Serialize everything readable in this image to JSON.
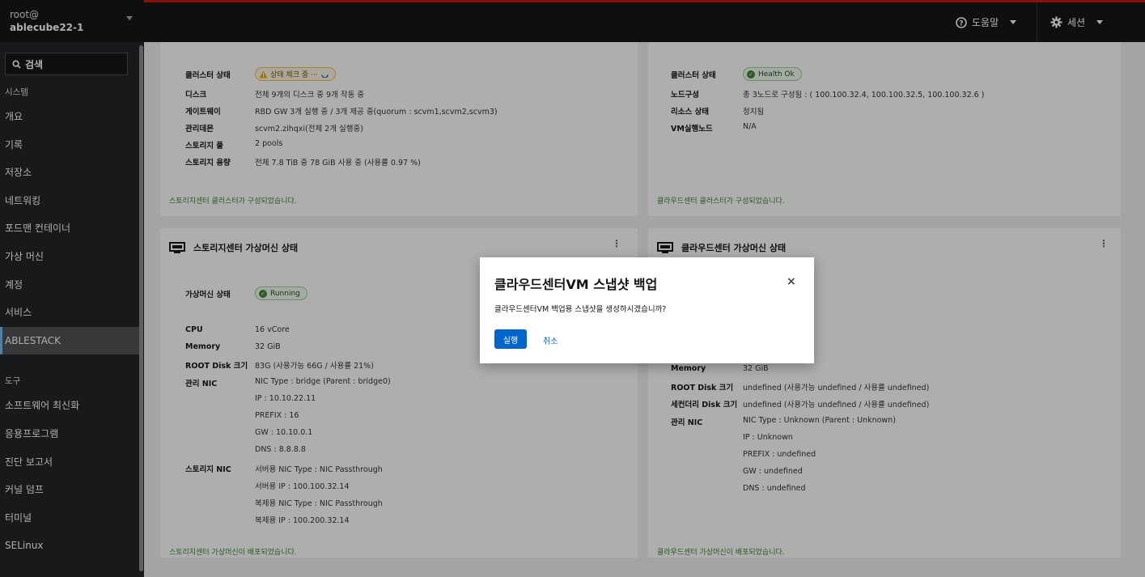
{
  "host": {
    "user": "root@",
    "name": "ablecube22-1"
  },
  "search": {
    "label": "검색"
  },
  "sidebar": {
    "items": [
      {
        "label": "시스템",
        "type": "section"
      },
      {
        "label": "개요"
      },
      {
        "label": "기록"
      },
      {
        "label": "저장소"
      },
      {
        "label": "네트워킹"
      },
      {
        "label": "포드맨 컨테이너"
      },
      {
        "label": "가상 머신"
      },
      {
        "label": "계정"
      },
      {
        "label": "서비스"
      },
      {
        "label": "ABLESTACK",
        "active": true
      },
      {
        "label": "도구",
        "type": "section"
      },
      {
        "label": "소프트웨어 최신화"
      },
      {
        "label": "응용프로그램"
      },
      {
        "label": "진단 보고서"
      },
      {
        "label": "커널 덤프"
      },
      {
        "label": "터미널"
      },
      {
        "label": "SELinux"
      }
    ]
  },
  "topbar": {
    "help": "도움말",
    "session": "세션"
  },
  "storage_cluster": {
    "status_label": "클러스터 상태",
    "status_badge": "상태 체크 중 ···",
    "rows": [
      {
        "k": "디스크",
        "v": "전체 9개의 디스크 중 9개 작동 중"
      },
      {
        "k": "게이트웨이",
        "v": "RBD GW 3개 실행 중 / 3개 제공 중(quorum : scvm1,scvm2,scvm3)"
      },
      {
        "k": "관리데몬",
        "v": "scvm2.zihqxi(전체 2개 실행중)"
      },
      {
        "k": "스토리지 풀",
        "v": "2 pools"
      },
      {
        "k": "스토리지 용량",
        "v": "전체 7.8 TiB 중 78 GiB 사용 중 (사용률 0.97 %)"
      }
    ],
    "footer": "스토리지센터 클러스터가 구성되었습니다."
  },
  "cloud_cluster": {
    "status_label": "클러스터 상태",
    "status_badge": "Health Ok",
    "rows": [
      {
        "k": "노드구성",
        "v": "총 3노드로 구성됨 : ( 100.100.32.4, 100.100.32.5, 100.100.32.6 )"
      },
      {
        "k": "리소스 상태",
        "v": "정지됨"
      },
      {
        "k": "VM실행노드",
        "v": "N/A"
      }
    ],
    "footer": "클라우드센터 클러스터가 구성되었습니다."
  },
  "storage_vm": {
    "title": "스토리지센터 가상머신 상태",
    "status_label": "가상머신 상태",
    "status_badge": "Running",
    "rows": [
      {
        "k": "CPU",
        "v": "16 vCore"
      },
      {
        "k": "Memory",
        "v": "32 GiB"
      },
      {
        "k": "ROOT Disk 크기",
        "v": "83G (사용가능 66G / 사용률 21%)"
      },
      {
        "k": "관리 NIC",
        "v": "NIC Type : bridge (Parent : bridge0)"
      },
      {
        "k": "",
        "v": "IP : 10.10.22.11"
      },
      {
        "k": "",
        "v": "PREFIX : 16"
      },
      {
        "k": "",
        "v": "GW : 10.10.0.1"
      },
      {
        "k": "",
        "v": "DNS : 8.8.8.8"
      },
      {
        "k": "스토리지 NIC",
        "v": "서버용 NIC Type : NIC Passthrough"
      },
      {
        "k": "",
        "v": "서버용 IP : 100.100.32.14"
      },
      {
        "k": "",
        "v": "복제용 NIC Type : NIC Passthrough"
      },
      {
        "k": "",
        "v": "복제용 IP : 100.200.32.14"
      }
    ],
    "footer": "스토리지센터 가상머신이 배포되었습니다."
  },
  "cloud_vm": {
    "title": "클라우드센터 가상머신 상태",
    "rows": [
      {
        "k": "Memory",
        "v": "32 GiB"
      },
      {
        "k": "ROOT Disk 크기",
        "v": "undefined (사용가능 undefined / 사용률 undefined)"
      },
      {
        "k": "세컨더리 Disk 크기",
        "v": "undefined (사용가능 undefined / 사용률 undefined)"
      },
      {
        "k": "관리 NIC",
        "v": "NIC Type : Unknown (Parent : Unknown)"
      },
      {
        "k": "",
        "v": "IP : Unknown"
      },
      {
        "k": "",
        "v": "PREFIX : undefined"
      },
      {
        "k": "",
        "v": "GW : undefined"
      },
      {
        "k": "",
        "v": "DNS : undefined"
      }
    ],
    "footer": "클라우드센터 가상머신이 배포되었습니다."
  },
  "modal": {
    "title": "클라우드센터VM 스냅샷 백업",
    "body": "클라우드센터VM 백업용 스냅샷을 생성하시겠습니까?",
    "run": "실행",
    "cancel": "취소",
    "close": "×"
  }
}
